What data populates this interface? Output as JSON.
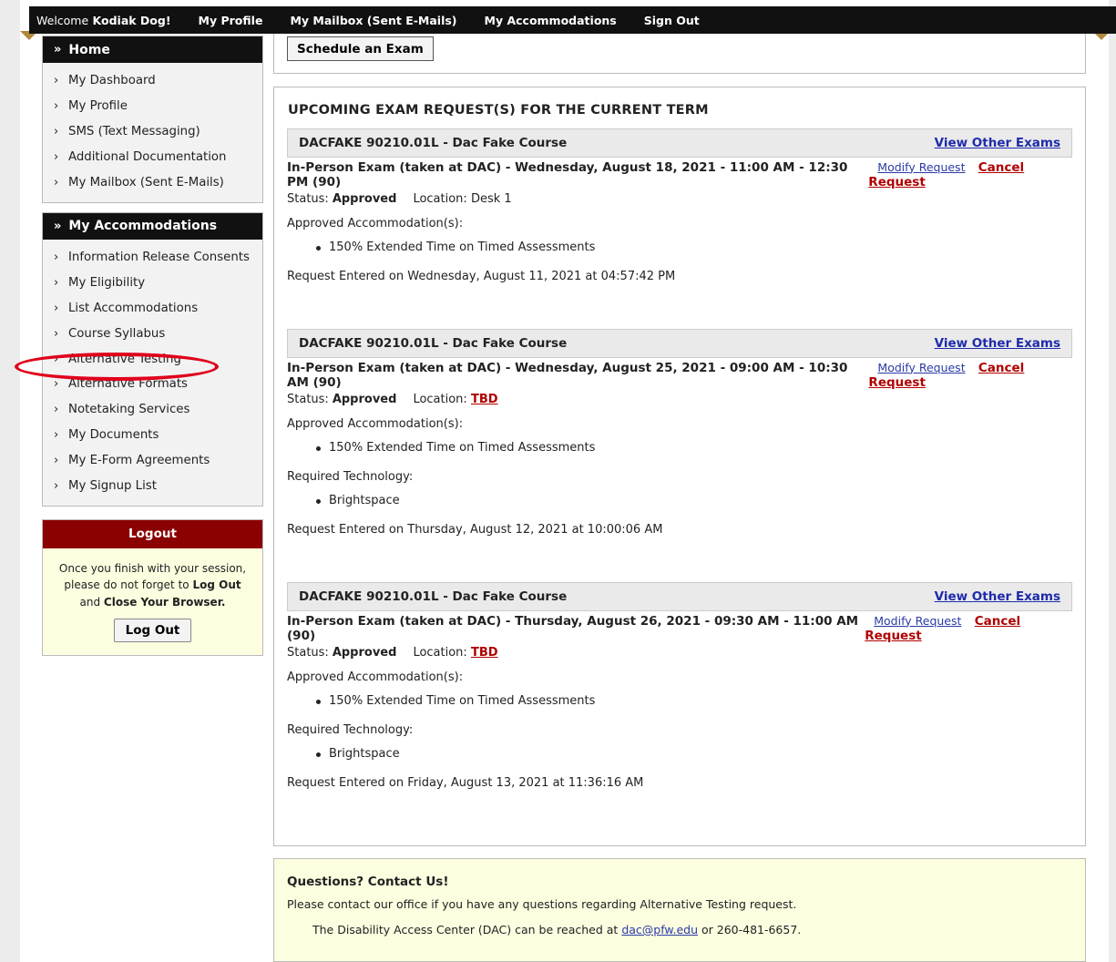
{
  "topbar": {
    "welcome_prefix": "Welcome",
    "user_name": "Kodiak Dog!",
    "links": [
      "My Profile",
      "My Mailbox (Sent E-Mails)",
      "My Accommodations",
      "Sign Out"
    ]
  },
  "sidebar": {
    "home": {
      "title": "Home",
      "items": [
        "My Dashboard",
        "My Profile",
        "SMS (Text Messaging)",
        "Additional Documentation",
        "My Mailbox (Sent E-Mails)"
      ]
    },
    "accommodations": {
      "title": "My Accommodations",
      "items": [
        "Information Release Consents",
        "My Eligibility",
        "List Accommodations",
        "Course Syllabus",
        "Alternative Testing",
        "Alternative Formats",
        "Notetaking Services",
        "My Documents",
        "My E-Form Agreements",
        "My Signup List"
      ]
    },
    "logout": {
      "title": "Logout",
      "text1": "Once you finish with your session, please do not forget to",
      "text_bold1": "Log Out",
      "text2": "and",
      "text_bold2": "Close Your Browser",
      "text3": ".",
      "button": "Log Out"
    }
  },
  "main": {
    "schedule_button": "Schedule an Exam",
    "section_title": "UPCOMING EXAM REQUEST(S) FOR THE CURRENT TERM",
    "labels": {
      "status": "Status:",
      "location": "Location:",
      "approved_accommodations": "Approved Accommodation(s):",
      "required_technology": "Required Technology:",
      "view_other": "View Other Exams",
      "modify": "Modify Request",
      "cancel": "Cancel Request"
    },
    "exams": [
      {
        "course": "DACFAKE 90210.01L - Dac Fake Course",
        "desc": "In-Person Exam (taken at DAC) - Wednesday, August 18, 2021 - 11:00 AM - 12:30 PM (90)",
        "status": "Approved",
        "location": "Desk 1",
        "accommodation": "150% Extended Time on Timed Assessments",
        "entered": "Request Entered on Wednesday, August 11, 2021 at 04:57:42 PM"
      },
      {
        "course": "DACFAKE 90210.01L - Dac Fake Course",
        "desc": "In-Person Exam (taken at DAC) - Wednesday, August 25, 2021 - 09:00 AM - 10:30 AM (90)",
        "status": "Approved",
        "location": "TBD",
        "accommodation": "150% Extended Time on Timed Assessments",
        "technology": "Brightspace",
        "entered": "Request Entered on Thursday, August 12, 2021 at 10:00:06 AM"
      },
      {
        "course": "DACFAKE 90210.01L - Dac Fake Course",
        "desc": "In-Person Exam (taken at DAC) - Thursday, August 26, 2021 - 09:30 AM - 11:00 AM (90)",
        "status": "Approved",
        "location": "TBD",
        "accommodation": "150% Extended Time on Timed Assessments",
        "technology": "Brightspace",
        "entered": "Request Entered on Friday, August 13, 2021 at 11:36:16 AM"
      }
    ]
  },
  "contact": {
    "title": "Questions? Contact Us!",
    "text": "Please contact our office if you have any questions regarding Alternative Testing request.",
    "text2_prefix": "The Disability Access Center (DAC) can be reached at",
    "email": "dac@pfw.edu",
    "text2_suffix": "or 260-481-6657."
  }
}
